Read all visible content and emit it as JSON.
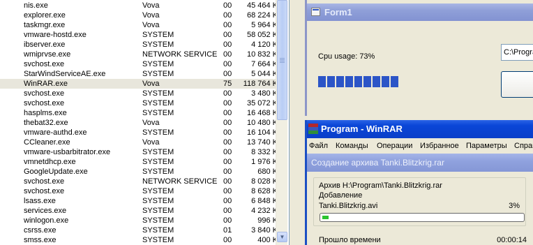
{
  "task_manager": {
    "rows": [
      {
        "name": "nis.exe",
        "user": "Vova",
        "cpu": "00",
        "mem": "45 464 K"
      },
      {
        "name": "explorer.exe",
        "user": "Vova",
        "cpu": "00",
        "mem": "68 224 K"
      },
      {
        "name": "taskmgr.exe",
        "user": "Vova",
        "cpu": "00",
        "mem": "5 964 K"
      },
      {
        "name": "vmware-hostd.exe",
        "user": "SYSTEM",
        "cpu": "00",
        "mem": "58 052 K"
      },
      {
        "name": "ibserver.exe",
        "user": "SYSTEM",
        "cpu": "00",
        "mem": "4 120 K"
      },
      {
        "name": "wmiprvse.exe",
        "user": "NETWORK SERVICE",
        "cpu": "00",
        "mem": "10 832 K"
      },
      {
        "name": "svchost.exe",
        "user": "SYSTEM",
        "cpu": "00",
        "mem": "7 664 K"
      },
      {
        "name": "StarWindServiceAE.exe",
        "user": "SYSTEM",
        "cpu": "00",
        "mem": "5 044 K"
      },
      {
        "name": "WinRAR.exe",
        "user": "Vova",
        "cpu": "75",
        "mem": "118 764 K"
      },
      {
        "name": "svchost.exe",
        "user": "SYSTEM",
        "cpu": "00",
        "mem": "3 480 K"
      },
      {
        "name": "svchost.exe",
        "user": "SYSTEM",
        "cpu": "00",
        "mem": "35 072 K"
      },
      {
        "name": "hasplms.exe",
        "user": "SYSTEM",
        "cpu": "00",
        "mem": "16 468 K"
      },
      {
        "name": "thebat32.exe",
        "user": "Vova",
        "cpu": "00",
        "mem": "10 480 K"
      },
      {
        "name": "vmware-authd.exe",
        "user": "SYSTEM",
        "cpu": "00",
        "mem": "16 104 K"
      },
      {
        "name": "CCleaner.exe",
        "user": "Vova",
        "cpu": "00",
        "mem": "13 740 K"
      },
      {
        "name": "vmware-usbarbitrator.exe",
        "user": "SYSTEM",
        "cpu": "00",
        "mem": "8 332 K"
      },
      {
        "name": "vmnetdhcp.exe",
        "user": "SYSTEM",
        "cpu": "00",
        "mem": "1 976 K"
      },
      {
        "name": "GoogleUpdate.exe",
        "user": "SYSTEM",
        "cpu": "00",
        "mem": "680 K"
      },
      {
        "name": "svchost.exe",
        "user": "NETWORK SERVICE",
        "cpu": "00",
        "mem": "8 028 K"
      },
      {
        "name": "svchost.exe",
        "user": "SYSTEM",
        "cpu": "00",
        "mem": "8 628 K"
      },
      {
        "name": "lsass.exe",
        "user": "SYSTEM",
        "cpu": "00",
        "mem": "6 848 K"
      },
      {
        "name": "services.exe",
        "user": "SYSTEM",
        "cpu": "00",
        "mem": "4 232 K"
      },
      {
        "name": "winlogon.exe",
        "user": "SYSTEM",
        "cpu": "00",
        "mem": "996 K"
      },
      {
        "name": "csrss.exe",
        "user": "SYSTEM",
        "cpu": "01",
        "mem": "3 840 K"
      },
      {
        "name": "smss.exe",
        "user": "SYSTEM",
        "cpu": "00",
        "mem": "400 K"
      }
    ],
    "selected_row": "WinRAR.exe"
  },
  "form1": {
    "title": "Form1",
    "cpu_label": "Cpu usage: 73%",
    "cpu_progress": 0.73,
    "path_value": "C:\\Program",
    "button_label": ""
  },
  "winrar": {
    "title": "Program - WinRAR",
    "menu": [
      "Файл",
      "Команды",
      "Операции",
      "Избранное",
      "Параметры",
      "Справка"
    ],
    "dialog_title": "Создание архива Tanki.Blitzkrig.rar",
    "archive_line": "Архив H:\\Program\\Tanki.Blitzkrig.rar",
    "action_line": "Добавление",
    "file_name": "Tanki.Blitzkrig.avi",
    "file_percent": "3%",
    "file_progress": 0.03,
    "elapsed_label": "Прошло времени",
    "elapsed_value": "00:00:14"
  },
  "colors": {
    "selection_row": "#e8e6dc",
    "xp_progress_block": "#2c55c7",
    "winrar_progress": "#2bc430",
    "inactive_titlebar": "#8f9fd8",
    "active_titlebar": "#0a46d7"
  }
}
